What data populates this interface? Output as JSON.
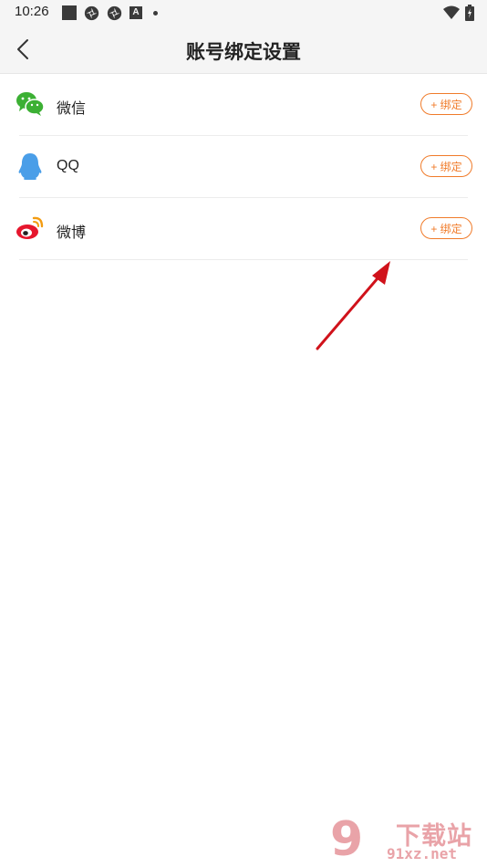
{
  "status_bar": {
    "time": "10:26",
    "left_icons": [
      "notification-square-icon",
      "app-round-icon",
      "app-round-icon",
      "a-badge-icon",
      "dot-icon"
    ],
    "a_badge_text": "A",
    "right_icons": [
      "wifi-icon",
      "battery-icon"
    ]
  },
  "header": {
    "title": "账号绑定设置",
    "back_icon": "chevron-left-icon"
  },
  "accounts": [
    {
      "icon": "wechat-icon",
      "label": "微信",
      "button": "+ 绑定",
      "icon_color": "#3cb034"
    },
    {
      "icon": "qq-icon",
      "label": "QQ",
      "button": "+ 绑定",
      "icon_color": "#4a9ee8"
    },
    {
      "icon": "weibo-icon",
      "label": "微博",
      "button": "+ 绑定",
      "icon_color": "#e6162d"
    }
  ],
  "colors": {
    "accent": "#f07b2a",
    "bar_background": "#f5f5f5",
    "annotation_arrow": "#d0121b"
  },
  "watermark": {
    "logo_digit": "9",
    "text": "下载站",
    "url": "91xz.net"
  }
}
